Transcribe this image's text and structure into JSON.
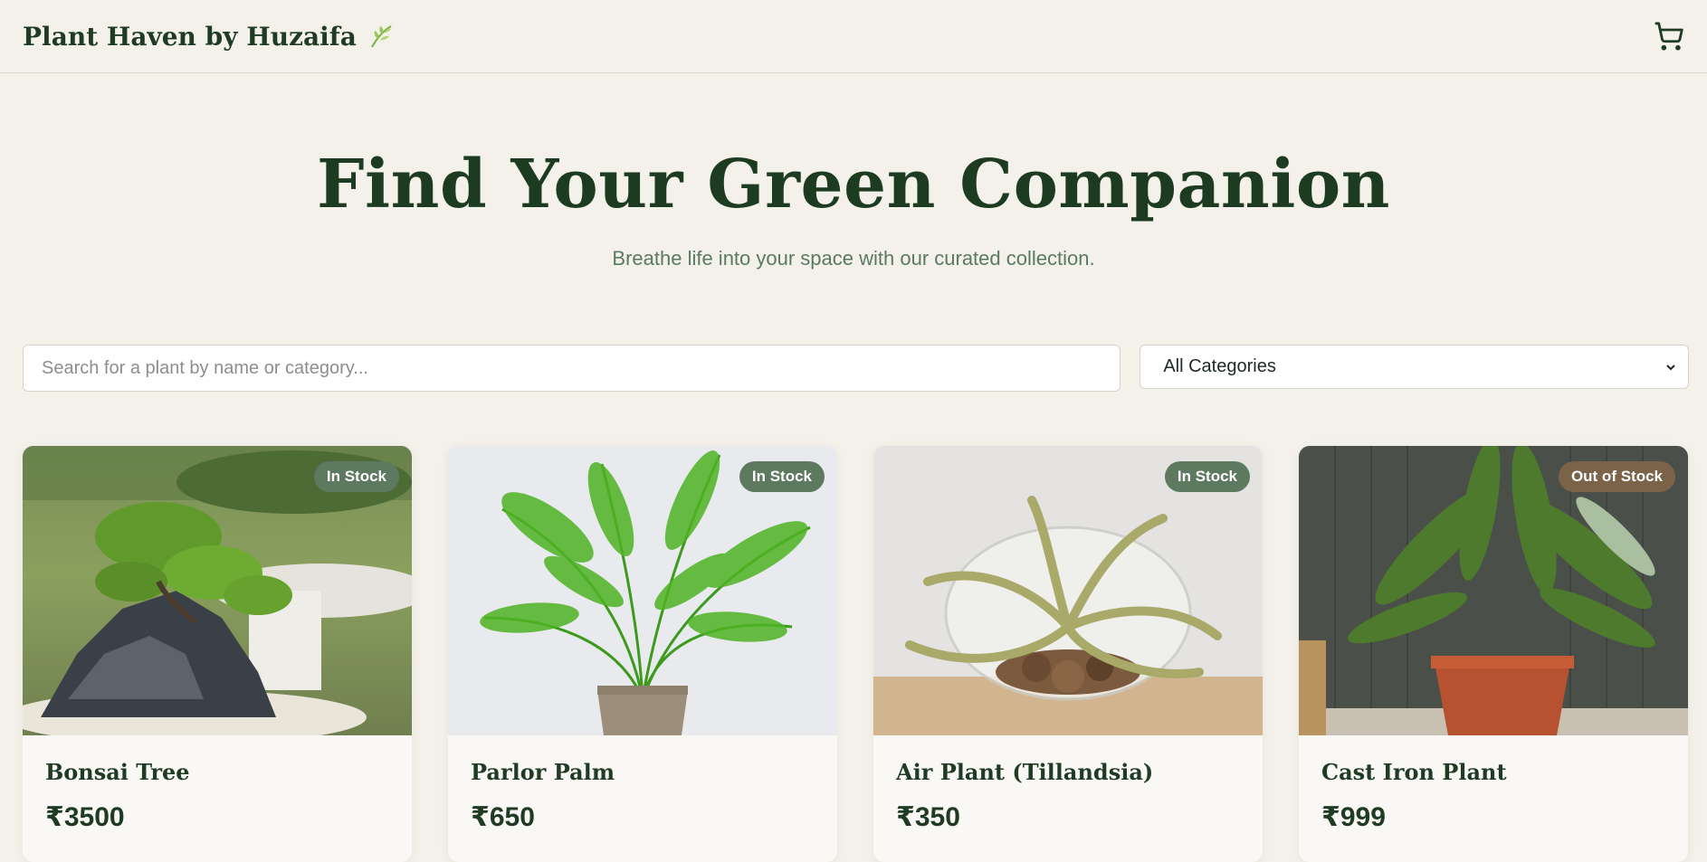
{
  "brand": {
    "name": "Plant Haven by Huzaifa",
    "icon": "leaf-icon"
  },
  "cart": {
    "icon": "cart-icon"
  },
  "hero": {
    "title": "Find Your Green Companion",
    "subtitle": "Breathe life into your space with our curated collection."
  },
  "search": {
    "placeholder": "Search for a plant by name or category..."
  },
  "category_filter": {
    "selected": "All Categories"
  },
  "colors": {
    "in_stock": "#5d7a61",
    "out_of_stock": "#7a6349",
    "accent": "#1f3b24"
  },
  "products": [
    {
      "name": "Bonsai Tree",
      "price": "₹3500",
      "stock": "In Stock"
    },
    {
      "name": "Parlor Palm",
      "price": "₹650",
      "stock": "In Stock"
    },
    {
      "name": "Air Plant (Tillandsia)",
      "price": "₹350",
      "stock": "In Stock"
    },
    {
      "name": "Cast Iron Plant",
      "price": "₹999",
      "stock": "Out of Stock"
    }
  ]
}
